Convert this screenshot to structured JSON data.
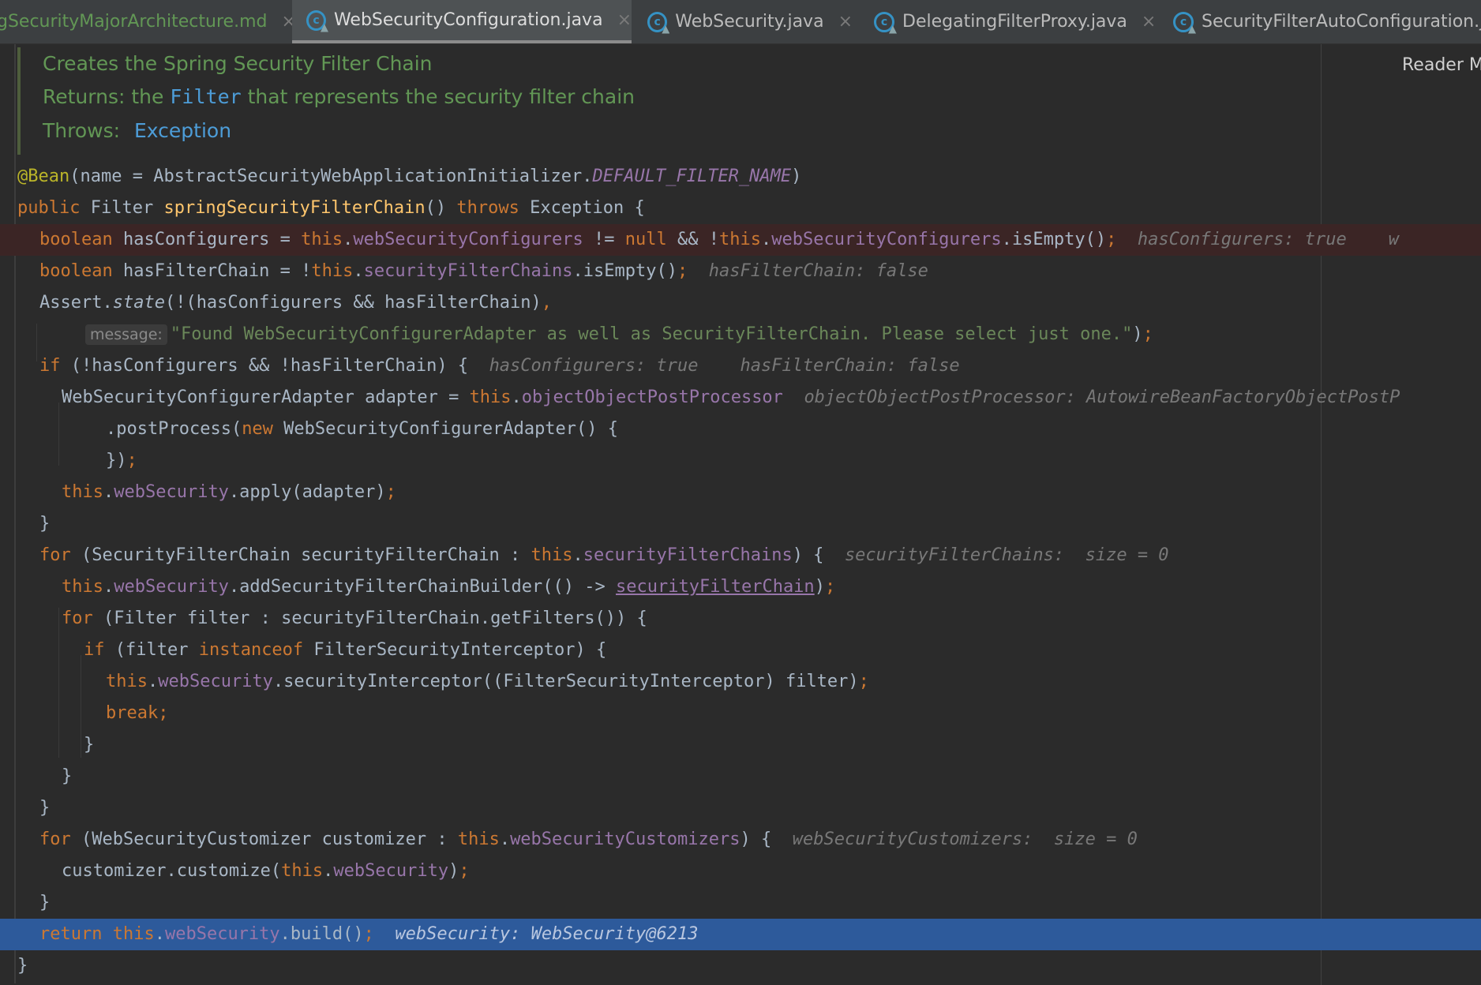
{
  "tabs": [
    {
      "label": "gSecurityMajorArchitecture.md",
      "icon": "markdown-file-icon",
      "active": false
    },
    {
      "label": "WebSecurityConfiguration.java",
      "icon": "java-class-icon",
      "active": true
    },
    {
      "label": "WebSecurity.java",
      "icon": "java-class-icon",
      "active": false
    },
    {
      "label": "DelegatingFilterProxy.java",
      "icon": "java-class-icon",
      "active": false
    },
    {
      "label": "SecurityFilterAutoConfiguration.j",
      "icon": "java-class-icon",
      "active": false
    }
  ],
  "tab_close_glyph": "×",
  "reader_mode": "Reader M",
  "doc": {
    "summary": "Creates the Spring Security Filter Chain",
    "returns_tag": "Returns:",
    "returns_pre": "the",
    "returns_link": "Filter",
    "returns_post": "that represents the security filter chain",
    "throws_tag": "Throws:",
    "throws_link": "Exception"
  },
  "code": {
    "l1": {
      "ann": "@Bean",
      "a": "(name = AbstractSecurityWebApplicationInitializer.",
      "const": "DEFAULT_FILTER_NAME",
      "b": ")"
    },
    "l2": {
      "kw1": "public",
      "a": " Filter ",
      "fn": "springSecurityFilterChain",
      "b": "() ",
      "kw2": "throws",
      "c": " Exception {"
    },
    "l3": {
      "kw1": "boolean",
      "a": " hasConfigurers = ",
      "this1": "this",
      "d1": ".",
      "f1": "webSecurityConfigurers",
      "b": " != ",
      "kw2": "null",
      "c": " && !",
      "this2": "this",
      "d2": ".",
      "f2": "webSecurityConfigurers",
      "e": ".isEmpty()",
      "semi": ";",
      "hint": "hasConfigurers: true",
      "hint2": "w"
    },
    "l4": {
      "kw1": "boolean",
      "a": " hasFilterChain = !",
      "this1": "this",
      "d1": ".",
      "f1": "securityFilterChains",
      "e": ".isEmpty()",
      "semi": ";",
      "hint": "hasFilterChain: false"
    },
    "l5": {
      "a": "Assert.",
      "it": "state",
      "b": "(!(hasConfigurers && hasFilterChain)",
      "comma": ","
    },
    "l6": {
      "param": "message:",
      "str": "\"Found WebSecurityConfigurerAdapter as well as SecurityFilterChain. Please select just one.\"",
      "b": ")",
      "semi": ";"
    },
    "l7": {
      "kw1": "if",
      "a": " (!hasConfigurers && !hasFilterChain) {",
      "hint1": "hasConfigurers: true",
      "hint2": "hasFilterChain: false"
    },
    "l8": {
      "a": "WebSecurityConfigurerAdapter adapter = ",
      "this1": "this",
      "d1": ".",
      "f1": "objectObjectPostProcessor",
      "hint": "objectObjectPostProcessor: AutowireBeanFactoryObjectPostP"
    },
    "l9": {
      "a": ".postProcess(",
      "kw1": "new",
      "b": " WebSecurityConfigurerAdapter() {"
    },
    "l10": {
      "a": "})",
      "semi": ";"
    },
    "l11": {
      "this1": "this",
      "d1": ".",
      "f1": "webSecurity",
      "a": ".apply(adapter)",
      "semi": ";"
    },
    "l12": {
      "a": "}"
    },
    "l13": {
      "kw1": "for",
      "a": " (SecurityFilterChain securityFilterChain : ",
      "this1": "this",
      "d1": ".",
      "f1": "securityFilterChains",
      "b": ") {",
      "hint1": "securityFilterChains:",
      "hint2": "size = 0"
    },
    "l14": {
      "this1": "this",
      "d1": ".",
      "f1": "webSecurity",
      "a": ".addSecurityFilterChainBuilder(() -> ",
      "ul": "securityFilterChain",
      "b": ")",
      "semi": ";"
    },
    "l15": {
      "kw1": "for",
      "a": " (Filter filter : securityFilterChain.getFilters()) {"
    },
    "l16": {
      "kw1": "if",
      "a": " (filter ",
      "kw2": "instanceof",
      "b": " FilterSecurityInterceptor) {"
    },
    "l17": {
      "this1": "this",
      "d1": ".",
      "f1": "webSecurity",
      "a": ".securityInterceptor((FilterSecurityInterceptor) filter)",
      "semi": ";"
    },
    "l18": {
      "kw1": "break",
      "semi": ";"
    },
    "l19": {
      "a": "}"
    },
    "l20": {
      "a": "}"
    },
    "l21": {
      "a": "}"
    },
    "l22": {
      "kw1": "for",
      "a": " (WebSecurityCustomizer customizer : ",
      "this1": "this",
      "d1": ".",
      "f1": "webSecurityCustomizers",
      "b": ") {",
      "hint1": "webSecurityCustomizers:",
      "hint2": "size = 0"
    },
    "l23": {
      "a": "customizer.customize(",
      "this1": "this",
      "d1": ".",
      "f1": "webSecurity",
      "b": ")",
      "semi": ";"
    },
    "l24": {
      "a": "}"
    },
    "l25": {
      "kw1": "return",
      "sp": " ",
      "this1": "this",
      "d1": ".",
      "f1": "webSecurity",
      "a": ".build()",
      "semi": ";",
      "hint": "webSecurity: WebSecurity@6213"
    },
    "l26": {
      "a": "}"
    }
  }
}
